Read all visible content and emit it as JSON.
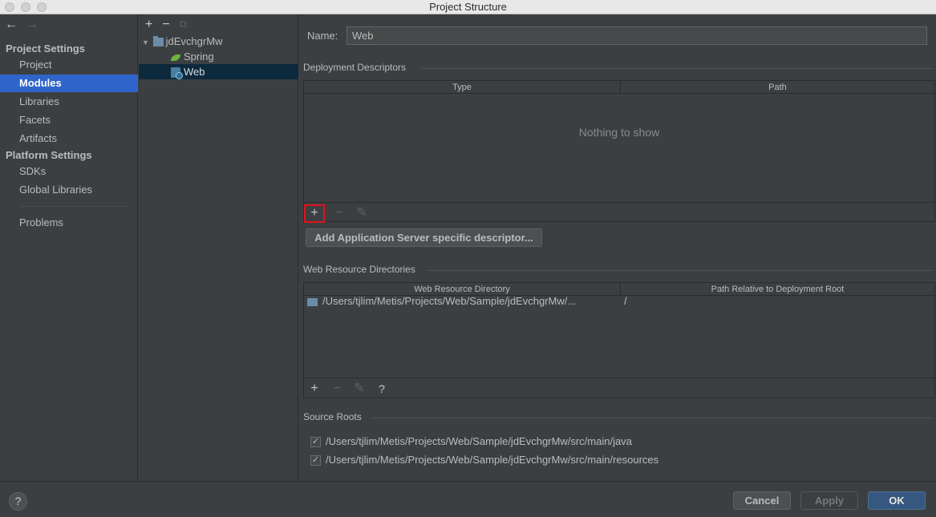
{
  "window": {
    "title": "Project Structure"
  },
  "nav": {
    "back_icon": "←",
    "forward_icon": "→",
    "project_settings_heading": "Project Settings",
    "project_settings_items": [
      "Project",
      "Modules",
      "Libraries",
      "Facets",
      "Artifacts"
    ],
    "platform_settings_heading": "Platform Settings",
    "platform_settings_items": [
      "SDKs",
      "Global Libraries"
    ],
    "problems_label": "Problems",
    "selected_item": "Modules"
  },
  "tree": {
    "toolbar": {
      "add": "+",
      "remove": "−",
      "copy": "⧉"
    },
    "root": "jdEvchgrMw",
    "children": [
      "Spring",
      "Web"
    ],
    "selected": "Web"
  },
  "module": {
    "name_label": "Name:",
    "name_value": "Web"
  },
  "deployment_descriptors": {
    "title": "Deployment Descriptors",
    "columns": [
      "Type",
      "Path"
    ],
    "empty_text": "Nothing to show",
    "toolbar": {
      "add": "+",
      "remove": "−",
      "edit": "✎"
    },
    "add_server_button": "Add Application Server specific descriptor..."
  },
  "web_resource_directories": {
    "title": "Web Resource Directories",
    "columns": [
      "Web Resource Directory",
      "Path Relative to Deployment Root"
    ],
    "rows": [
      {
        "directory": "/Users/tjlim/Metis/Projects/Web/Sample/jdEvchgrMw/...",
        "path": "/"
      }
    ],
    "toolbar": {
      "add": "+",
      "remove": "−",
      "edit": "✎",
      "help": "?"
    }
  },
  "source_roots": {
    "title": "Source Roots",
    "items": [
      {
        "checked": true,
        "path": "/Users/tjlim/Metis/Projects/Web/Sample/jdEvchgrMw/src/main/java"
      },
      {
        "checked": true,
        "path": "/Users/tjlim/Metis/Projects/Web/Sample/jdEvchgrMw/src/main/resources"
      }
    ],
    "check_mark": "✓"
  },
  "footer": {
    "help": "?",
    "cancel": "Cancel",
    "apply": "Apply",
    "ok": "OK"
  },
  "colors": {
    "selection": "#2f65ca",
    "ok_button": "#365880",
    "highlight_box": "#e0121f"
  }
}
